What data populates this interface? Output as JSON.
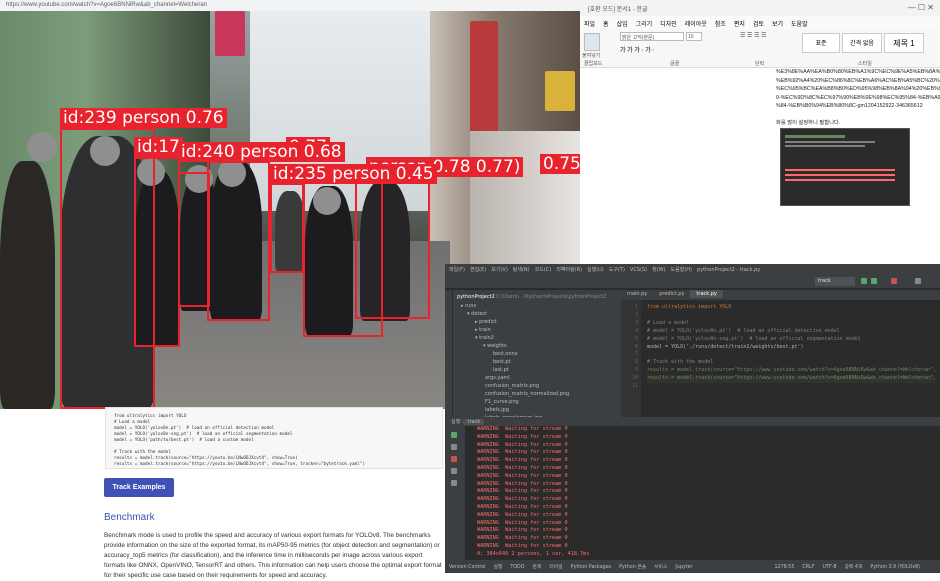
{
  "browser": {
    "url": "https://www.youtube.com/watch?v=Agoe6BNNiRw&ab_channel=Welcheran",
    "video": {
      "detections": [
        {
          "id_label": "id:239 person 0.76"
        },
        {
          "id_label": "id:17"
        },
        {
          "id_label": "id:240 person 0.68"
        },
        {
          "id_label": "id:235 person 0.45"
        },
        {
          "id_label": "person 0.78 0.77)"
        },
        {
          "id_label": "0.77"
        },
        {
          "id_label": "0.75"
        }
      ]
    },
    "docs": {
      "code_lines": [
        "from ultralytics import YOLO",
        "",
        "# Load a model",
        "model = YOLO('yolov8n.pt')  # load an official detection model",
        "model = YOLO('yolov8n-seg.pt')  # load an official segmentation model",
        "model = YOLO('path/to/best.pt')  # load a custom model",
        "",
        "# Track with the model",
        "results = model.track(source=\"https://youtu.be/LNwODJXcvt4\", show=True)",
        "results = model.track(source=\"https://youtu.be/LNwODJXcvt4\", show=True, tracker=\"bytetrack.yaml\")"
      ],
      "track_button": "Track Examples",
      "benchmark_title": "Benchmark",
      "benchmark_text": "Benchmark mode is used to profile the speed and accuracy of various export formats for YOLOv8. The benchmarks provide information on the size of the exported format, its mAP50-95 metrics (for object detection and segmentation) or accuracy_top5 metrics (for classification), and the inference time in milliseconds per image across various export formats like ONNX, OpenVINO, TensorRT and others. This information can help users choose the optimal export format for their specific use case based on their requirements for speed and accuracy."
    }
  },
  "hwp": {
    "title": "[호환 모드] 문서1 - 한글",
    "menu": [
      "파일",
      "홈",
      "삽입",
      "그리기",
      "디자인",
      "레이아웃",
      "참조",
      "편지",
      "검토",
      "보기",
      "도움말"
    ],
    "ribbon": {
      "font_name": "맑은 고딕(본문)",
      "font_size": "10",
      "groups": [
        "클립보드",
        "글꼴",
        "단락",
        "스타일"
      ],
      "styles": [
        "표준",
        "간격 없음",
        "제목 1"
      ],
      "paste": "붙여넣기"
    },
    "page_lines": [
      "%E3%8E%AA%EA%B0%80%EB%A1%9C%EC%9E%A5%EB%8A%94%20%EB%82%98%EC%95%BC",
      "%EB%92%A4%20%EC%86%8C%EB%A6%AC%EB%A5%BC%20%EC%9D%B4",
      "%EC%95%BC%EA%B8%B0%ED%95%98%EB%8A%94%20%EB%91%90%20",
      "0-%EC%9D%8C%EC%97%90%EB%9E%98%EC%95%84-%EB%A9%94%EB%A5",
      "%84-%EB%B0%94%EB%80%8C-gm1204152922-346365612",
      "",
      "화를 많이 설정하니 필합니다."
    ]
  },
  "ide": {
    "menu": [
      "파일(F)",
      "편집(E)",
      "보기(V)",
      "탐색(N)",
      "코드(C)",
      "리팩터링(R)",
      "실행(U)",
      "도구(T)",
      "VCS(S)",
      "창(W)",
      "도움말(H)",
      "pythonProject2 - track.py"
    ],
    "run_config": "track",
    "project": {
      "root": "pythonProject2",
      "root_path": "C:\\Users\\...\\PycharmProjects\\pythonProject2",
      "tree": [
        {
          "label": "runs",
          "indent": 1
        },
        {
          "label": "detect",
          "indent": 2
        },
        {
          "label": "predict",
          "indent": 3
        },
        {
          "label": "train",
          "indent": 3
        },
        {
          "label": "train2",
          "indent": 3
        },
        {
          "label": "weights",
          "indent": 4
        },
        {
          "label": "best.onnx",
          "indent": 5
        },
        {
          "label": "best.pt",
          "indent": 5
        },
        {
          "label": "last.pt",
          "indent": 5
        },
        {
          "label": "args.yaml",
          "indent": 4
        },
        {
          "label": "confusion_matrix.png",
          "indent": 4
        },
        {
          "label": "confusion_matrix_normalized.png",
          "indent": 4
        },
        {
          "label": "F1_curve.png",
          "indent": 4
        },
        {
          "label": "labels.jpg",
          "indent": 4
        },
        {
          "label": "labels_correlogram.jpg",
          "indent": 4
        }
      ]
    },
    "tabs": [
      "main.py",
      "predict.py",
      "track.py"
    ],
    "code_lines": [
      "from ultralytics import YOLO",
      "",
      "# Load a model",
      "# model = YOLO('yolov8n.pt')  # load an official detection model",
      "# model = YOLO('yolov8n-seg.pt')  # load an official segmentation model",
      "model = YOLO('./runs/detect/train2/weights/best.pt')",
      "",
      "# Track with the model",
      "results = model.track(source=\"https://www.youtube.com/watch?v=Agoe6BNNiRw&ab_channel=Welcheran\",",
      "results = model.track(source=\"https://www.youtube.com/watch?v=Agoe6BNNiRw&ab_channel=Welcheran\","
    ],
    "line_numbers": [
      "1",
      "2",
      "3",
      "4",
      "5",
      "6",
      "7",
      "8",
      "9",
      "10",
      "11"
    ],
    "run_tab": "track",
    "run_label": "실행",
    "console_lines": [
      "WARNING  Waiting for stream 0",
      "WARNING  Waiting for stream 0",
      "WARNING  Waiting for stream 0",
      "WARNING  Waiting for stream 0",
      "WARNING  Waiting for stream 0",
      "WARNING  Waiting for stream 0",
      "WARNING  Waiting for stream 0",
      "WARNING  Waiting for stream 0",
      "WARNING  Waiting for stream 0",
      "WARNING  Waiting for stream 0",
      "WARNING  Waiting for stream 0",
      "WARNING  Waiting for stream 0",
      "WARNING  Waiting for stream 0",
      "WARNING  Waiting for stream 0",
      "WARNING  Waiting for stream 0",
      "WARNING  Waiting for stream 0",
      "0: 384x640 2 persons, 1 car, 418.7ms"
    ],
    "status": {
      "left": [
        "Version Control",
        "실행",
        "TODO",
        "문제",
        "터미널",
        "Python Packages",
        "Python 콘솔",
        "서비스",
        "Jupyter"
      ],
      "right": [
        "1278:55",
        "CRLF",
        "UTF-8",
        "공백 4개",
        "Python 3.9 (YOLOv8)"
      ]
    }
  }
}
